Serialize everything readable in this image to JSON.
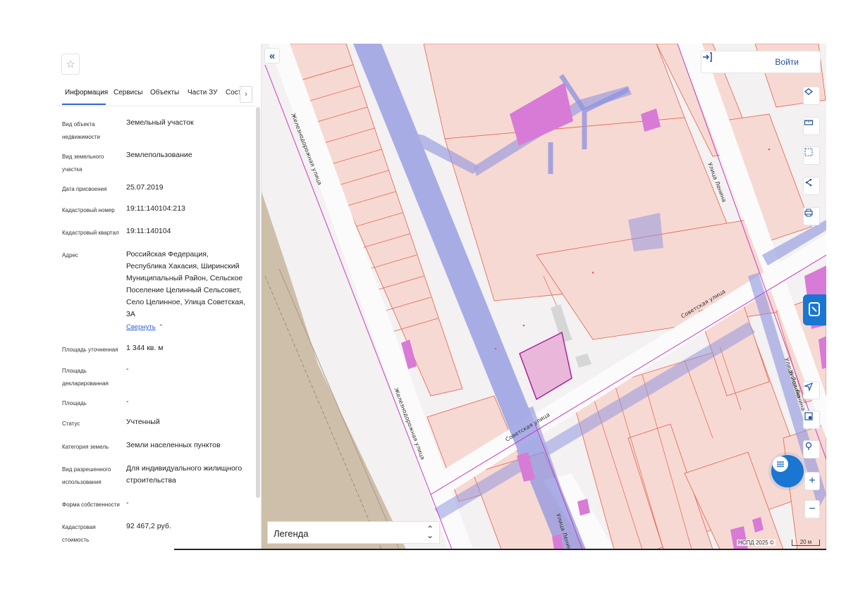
{
  "panel": {
    "tabs": [
      {
        "label": "Информация"
      },
      {
        "label": "Сервисы"
      },
      {
        "label": "Объекты"
      },
      {
        "label": "Части ЗУ"
      },
      {
        "label": "Соста"
      }
    ],
    "tab_scroll_icon": "chevron-right-icon",
    "rows": [
      {
        "label": "Вид объекта недвижимости",
        "value": "Земельный участок"
      },
      {
        "label": "Вид земельного участка",
        "value": "Землепользование"
      },
      {
        "label": "Дата присвоения",
        "value": "25.07.2019"
      },
      {
        "label": "Кадастровый номер",
        "value": "19:11:140104:213"
      },
      {
        "label": "Кадастровый квартал",
        "value": "19:11:140104"
      },
      {
        "label": "Адрес",
        "value": "Российская Федерация, Республика Хакасия, Ширинский Муниципальный Район, Сельское Поселение Целинный Сельсовет, Село Целинное, Улица Советская, 3А"
      },
      {
        "label": "Площадь уточненная",
        "value": "1 344 кв. м"
      },
      {
        "label": "Площадь декларированная",
        "value": "-"
      },
      {
        "label": "Площадь",
        "value": "-"
      },
      {
        "label": "Статус",
        "value": "Учтенный"
      },
      {
        "label": "Категория земель",
        "value": "Земли населенных пунктов"
      },
      {
        "label": "Вид разрешенного использования",
        "value": "Для индивидуального жилищного строительства"
      },
      {
        "label": "Форма собственности",
        "value": "-"
      },
      {
        "label": "Кадастровая стоимость",
        "value": "92 467,2 руб."
      }
    ],
    "collapse_link": "Свернуть"
  },
  "map": {
    "login_label": "Войти",
    "legend_label": "Легенда",
    "attribution": "НСПД 2025 ©",
    "scale_label": "20 м",
    "street_labels": {
      "zhel1": "Железнодорожная улица",
      "zhel2": "Железнодорожная улица",
      "sov1": "Советская улица",
      "sov2": "Советская улица",
      "lenina1": "Улица Ленина",
      "lenina2": "Улица Ленина",
      "lenina3": "Улица Ленина",
      "lenina4": "Улица Ленина"
    },
    "right_tools": [
      "layers-icon",
      "ruler-icon",
      "select-area-icon",
      "share-icon",
      "print-icon",
      "navigate-icon",
      "minimap-icon",
      "location-icon"
    ],
    "colors": {
      "parcel_fill": "#f7d9d3",
      "parcel_stroke": "#e0624f",
      "zone_blue": "#8f95e0",
      "building": "#d77bd6",
      "accent": "#1976d2",
      "railway": "#cdbfa9"
    }
  }
}
